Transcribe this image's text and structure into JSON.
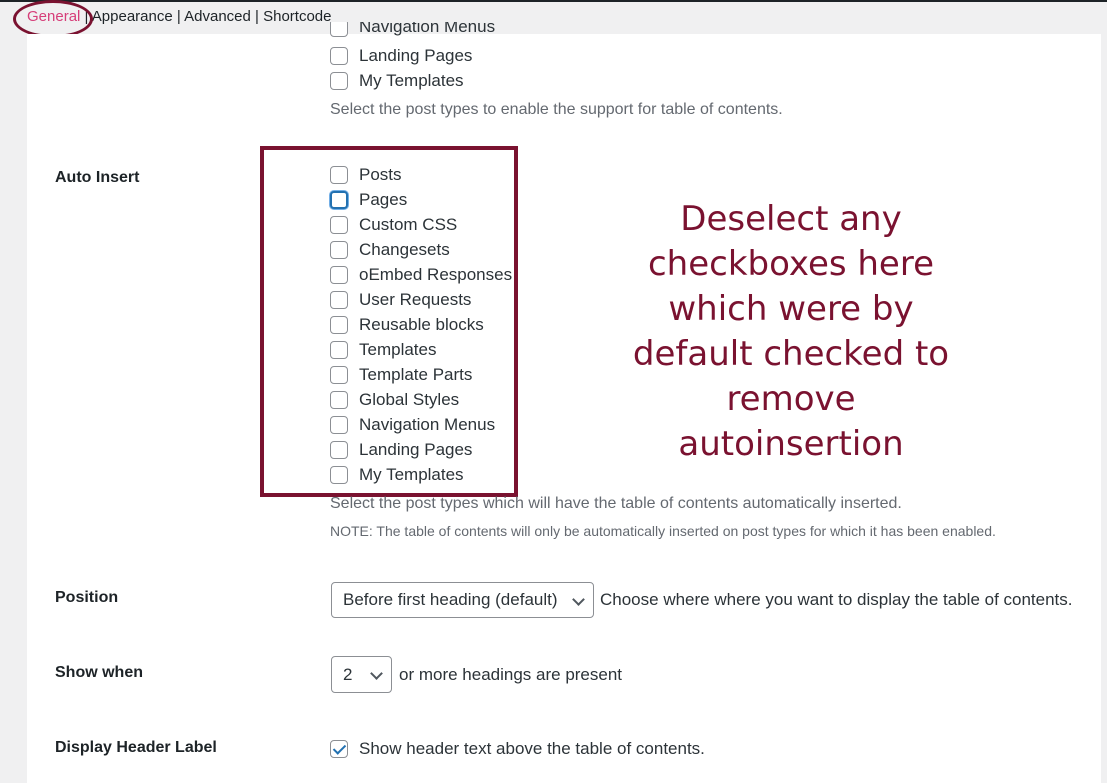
{
  "tabs": {
    "general": "General",
    "appearance": "Appearance",
    "advanced": "Advanced",
    "shortcode": "Shortcode",
    "separator": "|"
  },
  "support_section": {
    "items": [
      "Navigation Menus",
      "Landing Pages",
      "My Templates"
    ],
    "description": "Select the post types to enable the support for table of contents."
  },
  "auto_insert": {
    "label": "Auto Insert",
    "items": [
      "Posts",
      "Pages",
      "Custom CSS",
      "Changesets",
      "oEmbed Responses",
      "User Requests",
      "Reusable blocks",
      "Templates",
      "Template Parts",
      "Global Styles",
      "Navigation Menus",
      "Landing Pages",
      "My Templates"
    ],
    "description": "Select the post types which will have the table of contents automatically inserted.",
    "note": "NOTE: The table of contents will only be automatically inserted on post types for which it has been enabled."
  },
  "annotation": {
    "lines": [
      "Deselect any",
      "checkboxes here",
      "which were by",
      "default checked to",
      "remove",
      "autoinsertion"
    ]
  },
  "position": {
    "label": "Position",
    "selected": "Before first heading (default)",
    "description": "Choose where where you want to display the table of contents."
  },
  "show_when": {
    "label": "Show when",
    "selected": "2",
    "suffix": "or more headings are present"
  },
  "display_header": {
    "label": "Display Header Label",
    "checked": true,
    "text": "Show header text above the table of contents."
  },
  "colors": {
    "active_tab": "#d63e79",
    "annotation": "#7a1230",
    "focus": "#2271b1"
  }
}
